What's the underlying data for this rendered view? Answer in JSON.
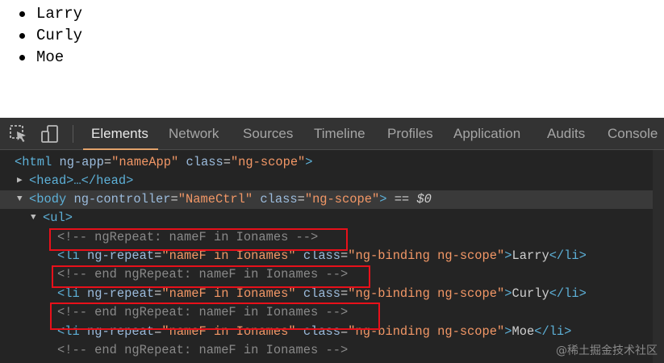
{
  "page": {
    "list_items": [
      "Larry",
      "Curly",
      "Moe"
    ]
  },
  "devtools": {
    "tabs": [
      "Elements",
      "Network",
      "Sources",
      "Timeline",
      "Profiles",
      "Application",
      "Audits",
      "Console"
    ],
    "active_tab": "Elements",
    "icons": [
      "inspect-element-icon",
      "device-mode-icon"
    ],
    "selection_marker": "== $0",
    "lines": {
      "html": {
        "tag": "html",
        "attr1": "ng-app",
        "val1": "\"nameApp\"",
        "attr2": "class",
        "val2": "\"ng-scope\""
      },
      "head": {
        "text": "<head>…</head>"
      },
      "body": {
        "tag": "body",
        "attr1": "ng-controller",
        "val1": "\"NameCtrl\"",
        "attr2": "class",
        "val2": "\"ng-scope\""
      },
      "ul": {
        "text": "<ul>"
      },
      "comment_start": "<!-- ngRepeat: nameF in Ionames -->",
      "li_attr1": "ng-repeat",
      "li_val1": "\"nameF in Ionames\"",
      "li_attr2": "class",
      "li_val2": "\"ng-binding ng-scope\"",
      "li_names": [
        "Larry",
        "Curly",
        "Moe"
      ],
      "comment_end": "<!-- end ngRepeat: nameF in Ionames -->"
    }
  },
  "colors": {
    "highlight_box": "#e8101a",
    "active_tab_underline": "#e3a36b"
  },
  "watermark": "@稀土掘金技术社区"
}
